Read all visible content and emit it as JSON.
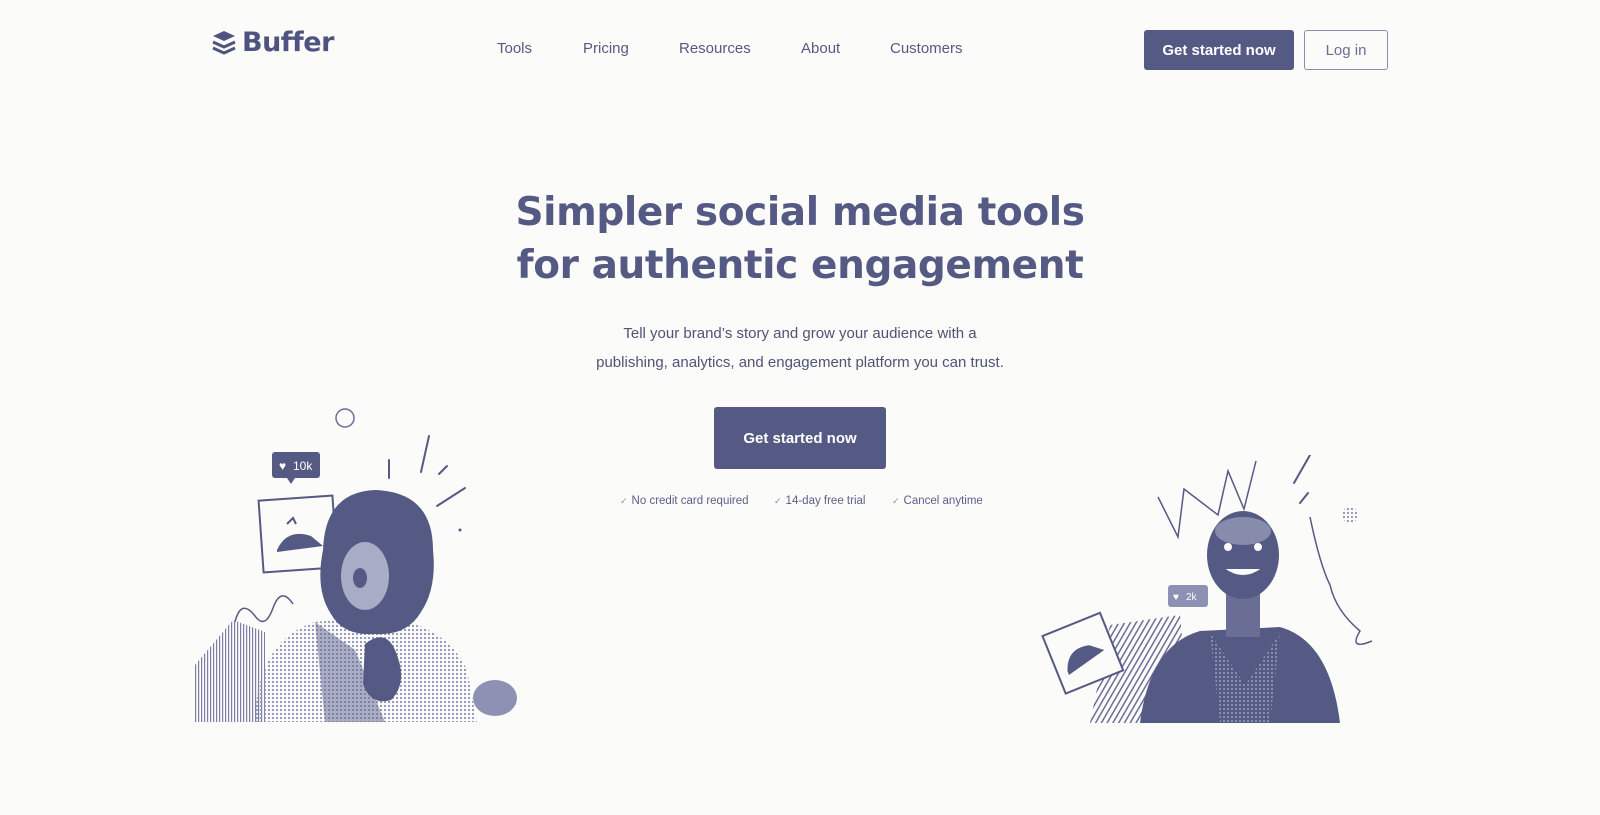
{
  "brand": {
    "name": "Buffer"
  },
  "nav": {
    "items": [
      "Tools",
      "Pricing",
      "Resources",
      "About",
      "Customers"
    ]
  },
  "header": {
    "cta_label": "Get started now",
    "login_label": "Log in"
  },
  "hero": {
    "title_lines": [
      "Simpler social media tools",
      "for authentic engagement"
    ],
    "subtitle_lines": [
      "Tell your brand’s story and grow your audience with a",
      "publishing, analytics, and engagement platform you can trust."
    ],
    "cta_label": "Get started now",
    "benefits": [
      "No credit card required",
      "14-day free trial",
      "Cancel anytime"
    ]
  },
  "illustrations": {
    "left_badge": "10k",
    "right_badge": "2k"
  },
  "colors": {
    "brand": "#555a85",
    "background": "#fbfbf9"
  },
  "icons": {
    "logo": "buffer-stack-icon",
    "benefit": "check-icon",
    "badge": "heart-icon"
  }
}
